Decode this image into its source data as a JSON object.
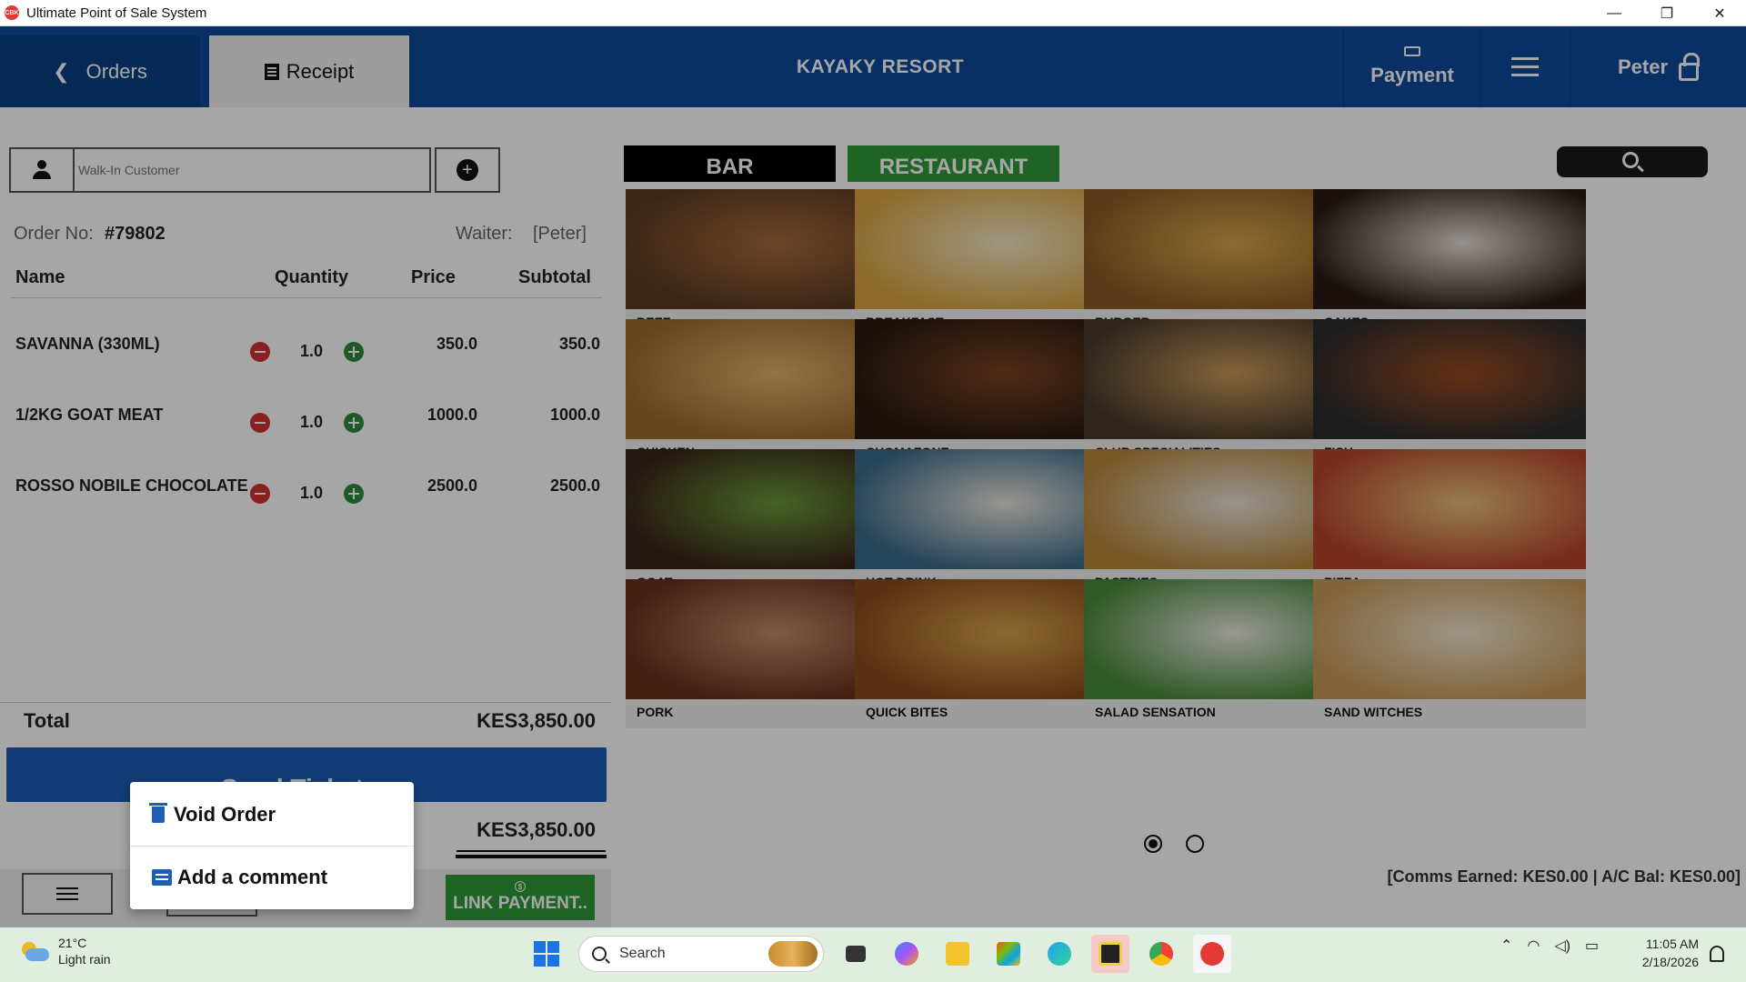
{
  "window": {
    "title": "Ultimate Point of Sale System",
    "minimize": "—",
    "maximize": "❐",
    "close": "✕"
  },
  "header": {
    "orders_tab": "Orders",
    "receipt_tab": "Receipt",
    "resort_name": "KAYAKY RESORT",
    "payment_label": "Payment",
    "user_name": "Peter"
  },
  "customer": {
    "placeholder": "Walk-In Customer"
  },
  "order": {
    "order_no_label": "Order No:",
    "order_no": "#79802",
    "waiter_label": "Waiter:",
    "waiter": "[Peter]",
    "columns": {
      "name": "Name",
      "quantity": "Quantity",
      "price": "Price",
      "subtotal": "Subtotal"
    },
    "items": [
      {
        "name": "SAVANNA (330ML)",
        "qty": "1.0",
        "price": "350.0",
        "subtotal": "350.0"
      },
      {
        "name": "1/2KG  GOAT MEAT",
        "qty": "1.0",
        "price": "1000.0",
        "subtotal": "1000.0"
      },
      {
        "name": "ROSSO NOBILE CHOCOLATE",
        "qty": "1.0",
        "price": "2500.0",
        "subtotal": "2500.0"
      }
    ],
    "total_label": "Total",
    "total_value": "KES3,850.00",
    "send_ticket": "Send Ticket ...",
    "total_value_2": "KES3,850.00",
    "link_payment": "LINK PAYMENT.."
  },
  "categories": {
    "tabs": [
      {
        "label": "BAR",
        "color": "#000000"
      },
      {
        "label": "RESTAURANT",
        "color": "#2e9b3a"
      }
    ],
    "items": [
      {
        "label": "BEEF",
        "c1": "#5a3a22",
        "c2": "#a86a3c"
      },
      {
        "label": "BREAKFAST",
        "c1": "#d9a441",
        "c2": "#f4e7c4"
      },
      {
        "label": "BURGER",
        "c1": "#8a5a26",
        "c2": "#d9a54a"
      },
      {
        "label": "CAKES",
        "c1": "#2a1c16",
        "c2": "#e8e0da"
      },
      {
        "label": "CHICKEN",
        "c1": "#9a6a2e",
        "c2": "#e2b26a"
      },
      {
        "label": "CHOMAZONE",
        "c1": "#2a1a10",
        "c2": "#7a4222"
      },
      {
        "label": "CLUB SPECIALITIES",
        "c1": "#4a3a2c",
        "c2": "#c99a5a"
      },
      {
        "label": "FISH",
        "c1": "#2c2c2c",
        "c2": "#9a4a22"
      },
      {
        "label": "GOAT",
        "c1": "#3a2218",
        "c2": "#6a9a3a"
      },
      {
        "label": "HOT DRINK",
        "c1": "#3a6a8a",
        "c2": "#e8e4dc"
      },
      {
        "label": "PASTRIES",
        "c1": "#b8863a",
        "c2": "#e8e2d8"
      },
      {
        "label": "PIZZA",
        "c1": "#b8442a",
        "c2": "#e8c07a"
      },
      {
        "label": "PORK",
        "c1": "#6a2e1c",
        "c2": "#c48a6a"
      },
      {
        "label": "QUICK BITES",
        "c1": "#8a4a1c",
        "c2": "#d9a24a"
      },
      {
        "label": "SALAD SENSATION",
        "c1": "#4a8a3a",
        "c2": "#e8e8e0"
      },
      {
        "label": "SAND WITCHES",
        "c1": "#c89a5a",
        "c2": "#f0e4cc"
      }
    ]
  },
  "footer": {
    "comms": "[Comms Earned: KES0.00 | A/C Bal: KES0.00]"
  },
  "popup": {
    "void_order": "Void Order",
    "add_comment": "Add a comment"
  },
  "taskbar": {
    "temperature": "21°C",
    "weather": "Light rain",
    "search_placeholder": "Search",
    "time": "11:05 AM",
    "date": "2/18/2026"
  }
}
